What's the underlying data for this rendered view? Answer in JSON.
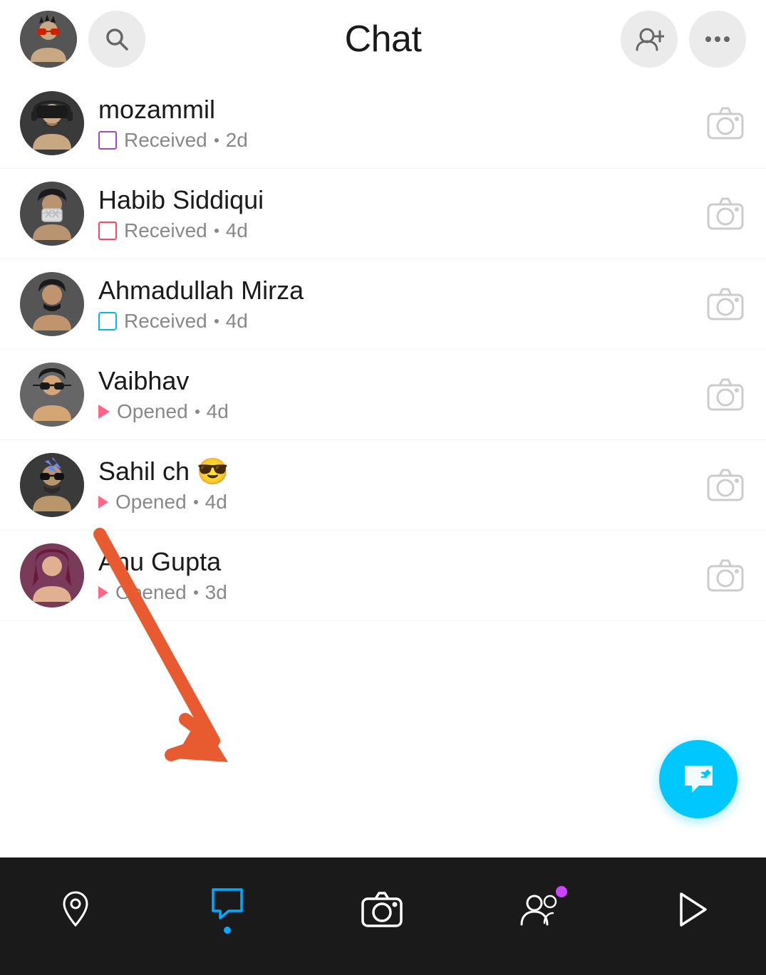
{
  "header": {
    "title": "Chat",
    "search_label": "search",
    "add_friend_label": "add friend",
    "more_label": "more options"
  },
  "chats": [
    {
      "id": 1,
      "name": "mozammil",
      "status": "Received",
      "status_type": "received_purple",
      "time": "2d",
      "avatar_emoji": "🧑"
    },
    {
      "id": 2,
      "name": "Habib Siddiqui",
      "status": "Received",
      "status_type": "received_red",
      "time": "4d",
      "avatar_emoji": "🧑"
    },
    {
      "id": 3,
      "name": "Ahmadullah Mirza",
      "status": "Received",
      "status_type": "received_cyan",
      "time": "4d",
      "avatar_emoji": "🧑"
    },
    {
      "id": 4,
      "name": "Vaibhav",
      "status": "Opened",
      "status_type": "opened_pink",
      "time": "4d",
      "avatar_emoji": "🧑"
    },
    {
      "id": 5,
      "name": "Sahil ch 😎",
      "status": "Opened",
      "status_type": "opened_pink",
      "time": "4d",
      "avatar_emoji": "🧑"
    },
    {
      "id": 6,
      "name": "Anu Gupta",
      "status": "Opened",
      "status_type": "opened_pink",
      "time": "3d",
      "avatar_emoji": "🧑"
    }
  ],
  "fab": {
    "label": "compose"
  },
  "bottom_nav": {
    "items": [
      {
        "id": "map",
        "icon": "map-pin",
        "label": "Map",
        "active": false,
        "has_dot": false
      },
      {
        "id": "chat",
        "icon": "chat-bubble",
        "label": "Chat",
        "active": true,
        "has_dot": false
      },
      {
        "id": "camera",
        "icon": "camera",
        "label": "Camera",
        "active": false,
        "has_dot": false
      },
      {
        "id": "friends",
        "icon": "friends",
        "label": "Friends",
        "active": false,
        "has_dot": true
      },
      {
        "id": "spotlight",
        "icon": "play",
        "label": "Spotlight",
        "active": false,
        "has_dot": false
      }
    ]
  }
}
